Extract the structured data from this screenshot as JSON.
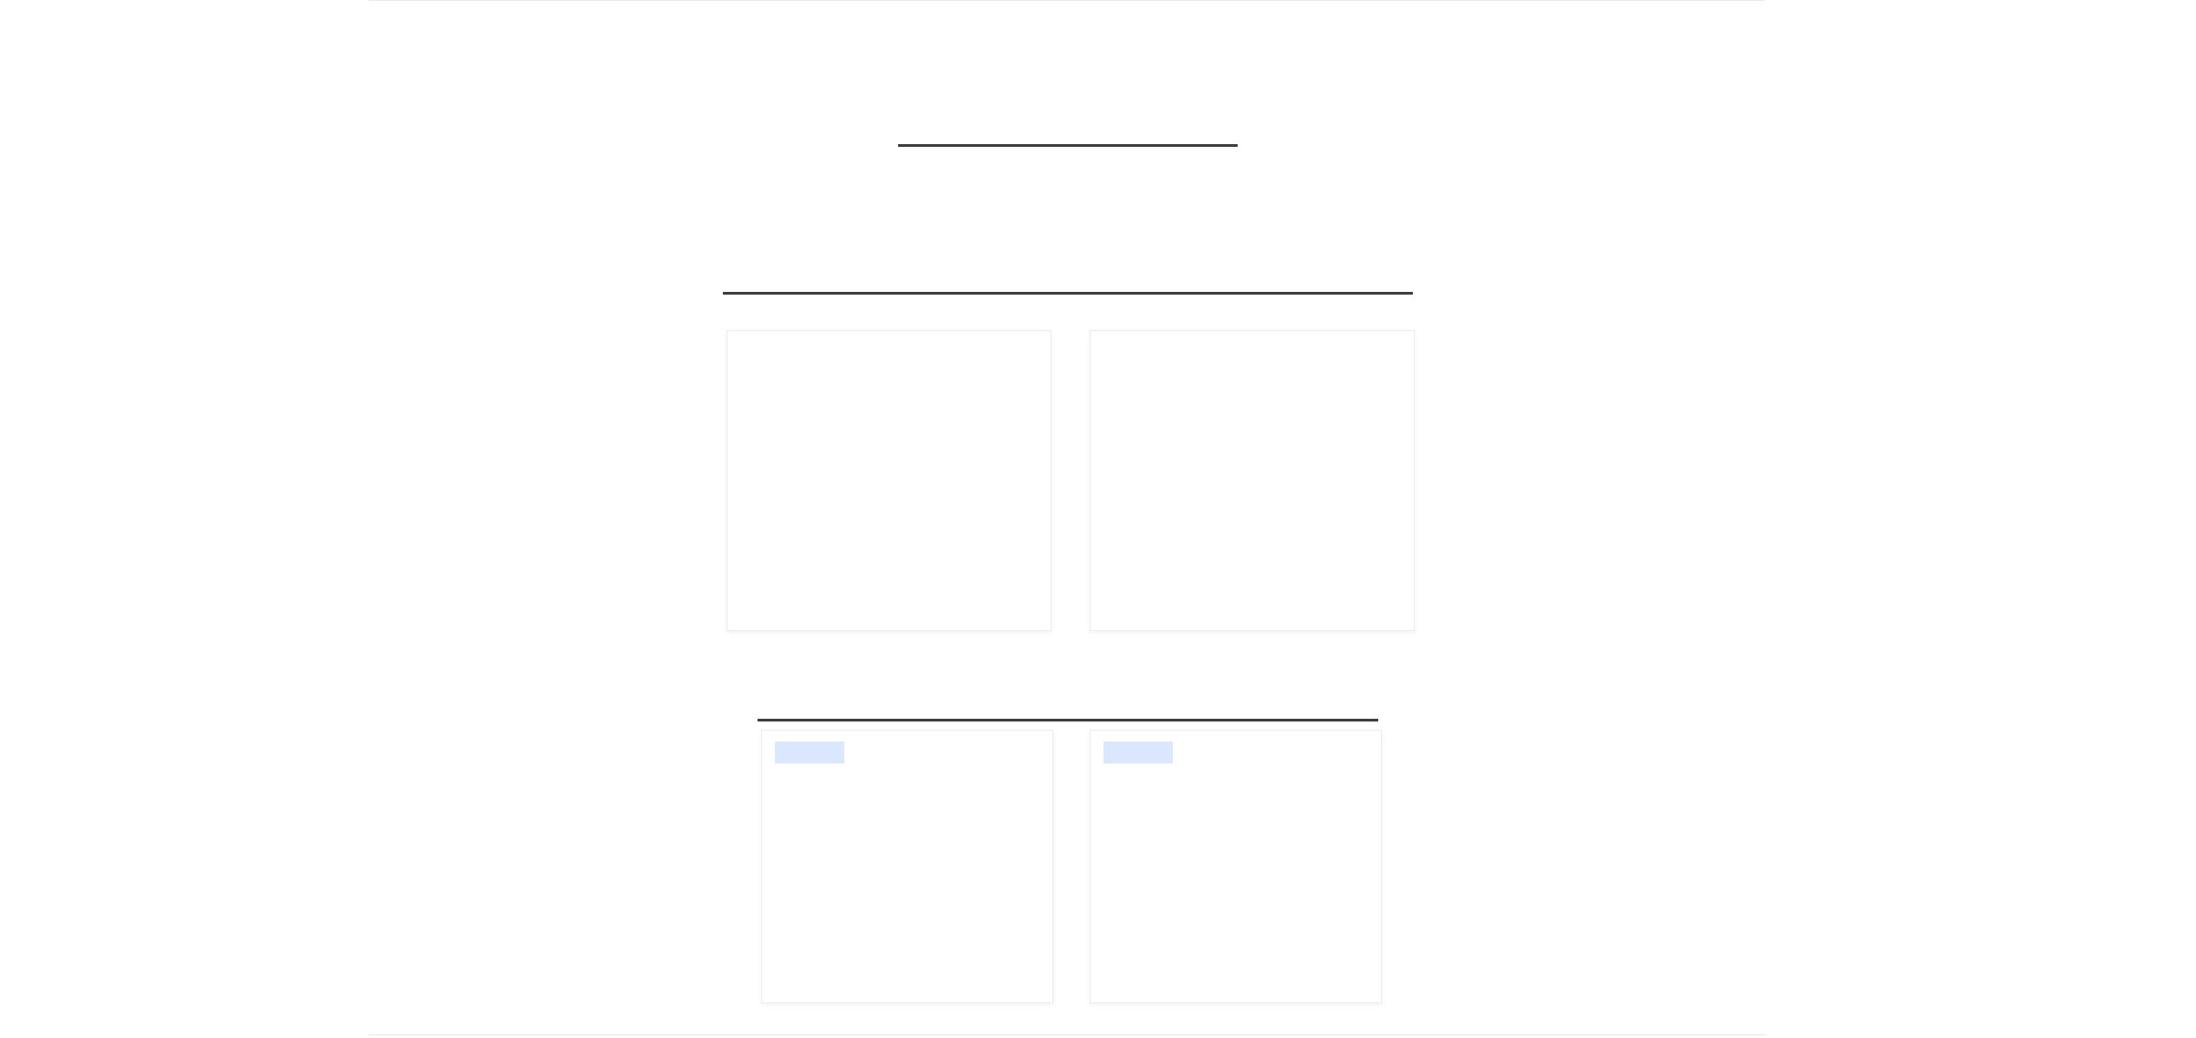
{
  "headline": "",
  "section1": {
    "title": "",
    "text": ""
  },
  "section2": {
    "title": "",
    "cards": [
      {
        "title": "",
        "lines": [
          "",
          "",
          "",
          "",
          ""
        ],
        "link": ""
      },
      {
        "title": "",
        "lines": [
          "",
          "",
          "",
          "",
          ""
        ],
        "link": ""
      }
    ]
  },
  "section3": {
    "title": "",
    "cards": [
      {
        "tag": "",
        "title": "",
        "highlight": "",
        "highlight_rest": "",
        "lines": [
          "",
          "",
          ""
        ],
        "footer": ""
      },
      {
        "tag": "",
        "title": "",
        "lines": [
          "",
          "",
          "",
          ""
        ],
        "footer": ""
      }
    ]
  },
  "colors": {
    "link": "#3366ff",
    "tag_bg": "#dbe6ff",
    "tag_text": "#2f56c9",
    "highlight": "#e03030",
    "section_rule": "#3f3f3f"
  }
}
